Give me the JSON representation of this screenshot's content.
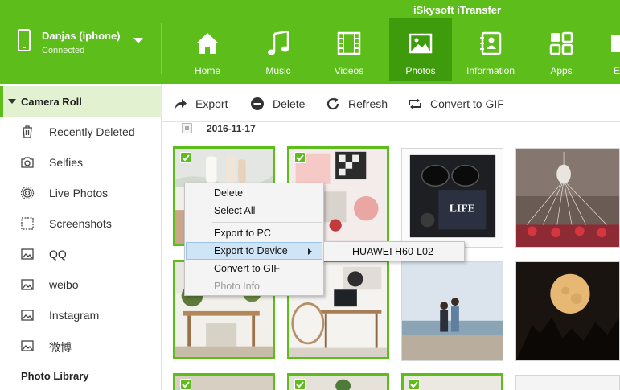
{
  "app": {
    "title": "iSkysoft iTransfer"
  },
  "device": {
    "name": "Danjas (iphone)",
    "status": "Connected"
  },
  "nav": [
    {
      "label": "Home",
      "icon": "home-icon"
    },
    {
      "label": "Music",
      "icon": "music-icon"
    },
    {
      "label": "Videos",
      "icon": "film-icon"
    },
    {
      "label": "Photos",
      "icon": "photo-icon",
      "active": true
    },
    {
      "label": "Information",
      "icon": "contacts-icon"
    },
    {
      "label": "Apps",
      "icon": "apps-icon"
    },
    {
      "label": "E",
      "icon": "more-icon"
    }
  ],
  "sidebar": {
    "section": "Camera Roll",
    "items": [
      {
        "label": "Recently Deleted",
        "icon": "trash-icon"
      },
      {
        "label": "Selfies",
        "icon": "camera-icon"
      },
      {
        "label": "Live Photos",
        "icon": "live-photo-icon"
      },
      {
        "label": "Screenshots",
        "icon": "screenshot-icon"
      },
      {
        "label": "QQ",
        "icon": "album-icon"
      },
      {
        "label": "weibo",
        "icon": "album-icon"
      },
      {
        "label": "Instagram",
        "icon": "album-icon"
      },
      {
        "label": "微博",
        "icon": "album-icon"
      }
    ],
    "library": "Photo Library"
  },
  "toolbar": {
    "export": "Export",
    "delete": "Delete",
    "refresh": "Refresh",
    "convert": "Convert to GIF"
  },
  "group": {
    "date": "2016-11-17"
  },
  "context_menu": {
    "items": [
      "Delete",
      "Select All",
      "Export to PC",
      "Export to Device",
      "Convert to GIF",
      "Photo Info"
    ],
    "highlighted": "Export to Device",
    "disabled": "Photo Info"
  },
  "submenu": {
    "items": [
      "HUAWEI H60-L02"
    ]
  },
  "colors": {
    "brand": "#5cbd1b",
    "active_tab": "#3e9c0c",
    "sidebar_active": "#e2f2d0",
    "menu_highlight": "#cfe4f7"
  }
}
